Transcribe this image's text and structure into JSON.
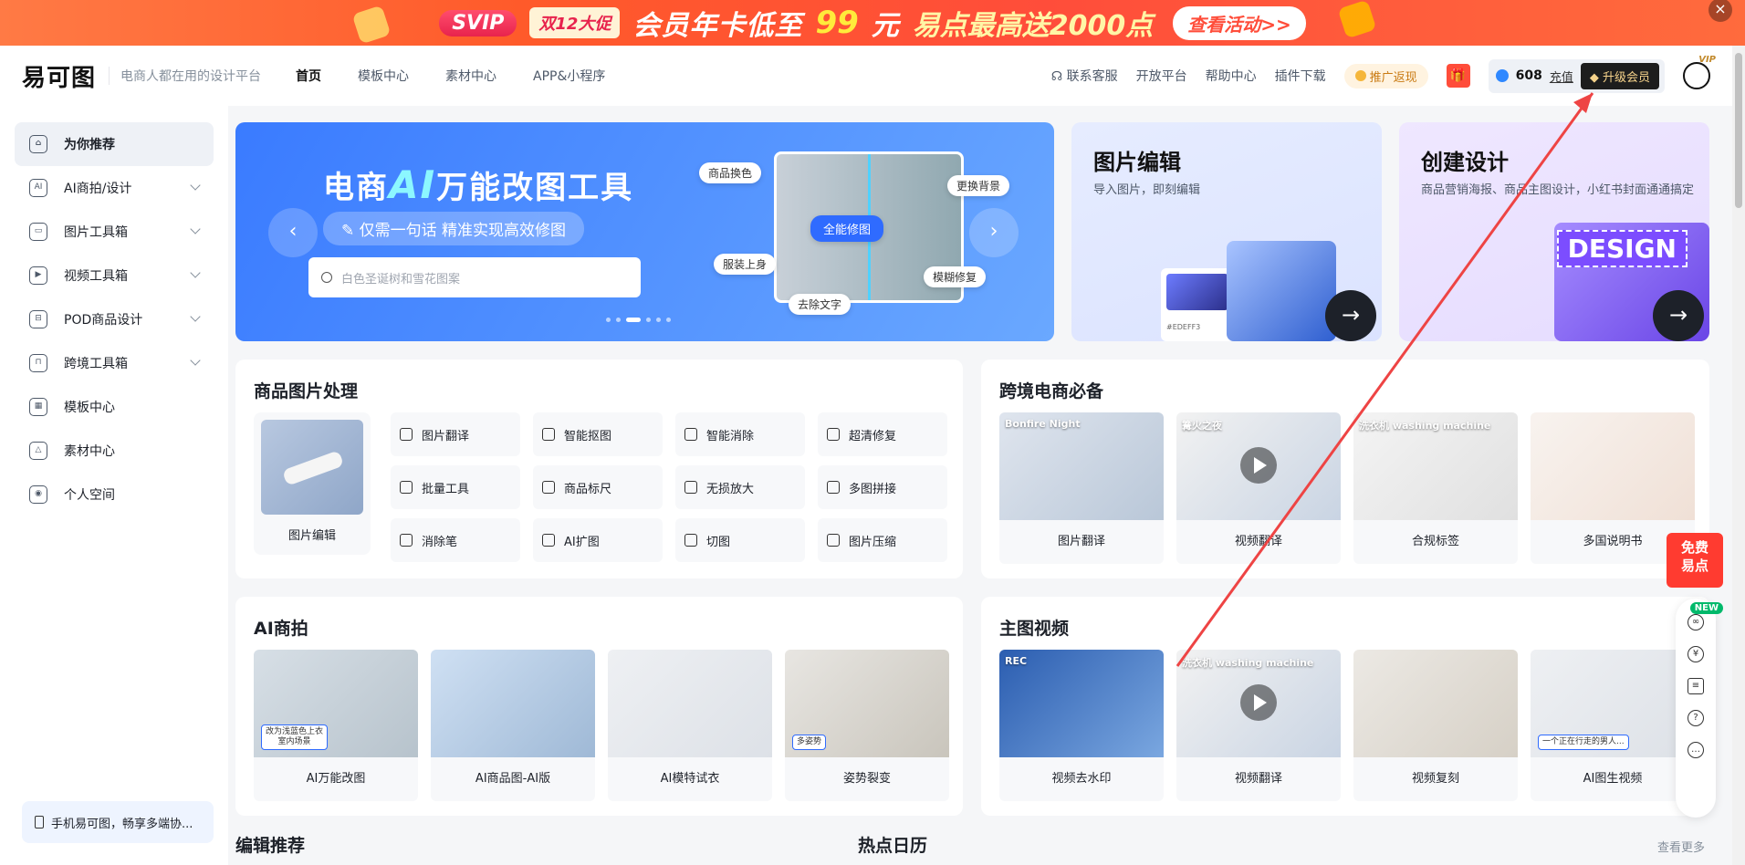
{
  "promo": {
    "svip": "SVIP",
    "double12": "双12大促",
    "text1": "会员年卡低至",
    "price": "99",
    "unit": "元",
    "text2": "易点最高送2000点",
    "cta": "查看活动>>",
    "close": "×"
  },
  "header": {
    "logo": "易可图",
    "slogan": "电商人都在用的设计平台",
    "nav": [
      "首页",
      "模板中心",
      "素材中心",
      "APP&小程序"
    ],
    "links": [
      "联系客服",
      "开放平台",
      "帮助中心",
      "插件下载"
    ],
    "promo_return": "推广返现",
    "points": "608",
    "recharge": "充值",
    "upgrade": "升级会员",
    "vip": "VIP"
  },
  "sidebar": {
    "items": [
      {
        "label": "为你推荐",
        "icon": "home-icon",
        "glyph": "⌂",
        "chevron": false
      },
      {
        "label": "AI商拍/设计",
        "icon": "ai-icon",
        "glyph": "AI",
        "chevron": true
      },
      {
        "label": "图片工具箱",
        "icon": "toolbox-icon",
        "glyph": "▭",
        "chevron": true
      },
      {
        "label": "视频工具箱",
        "icon": "video-icon",
        "glyph": "▶",
        "chevron": true
      },
      {
        "label": "POD商品设计",
        "icon": "pod-icon",
        "glyph": "⊟",
        "chevron": true
      },
      {
        "label": "跨境工具箱",
        "icon": "crossborder-icon",
        "glyph": "⊓",
        "chevron": true
      },
      {
        "label": "模板中心",
        "icon": "template-icon",
        "glyph": "▦",
        "chevron": false
      },
      {
        "label": "素材中心",
        "icon": "material-icon",
        "glyph": "△",
        "chevron": false
      },
      {
        "label": "个人空间",
        "icon": "user-icon",
        "glyph": "◉",
        "chevron": false
      }
    ],
    "bottom": "手机易可图，畅享多端协..."
  },
  "hero": {
    "title_a": "电商",
    "title_ai": "AI",
    "title_b": "万能改图工具",
    "subtitle": "仅需一句话 精准实现高效修图",
    "search_placeholder": "白色圣诞树和雪花图案",
    "tags": [
      "商品换色",
      "更换背景",
      "全能修图",
      "服装上身",
      "模糊修复",
      "去除文字"
    ],
    "prev": "‹",
    "next": "›"
  },
  "card_edit": {
    "title": "图片编辑",
    "subtitle": "导入图片，即刻编辑",
    "go": "→",
    "swatch": "#EDEFF3"
  },
  "card_create": {
    "title": "创建设计",
    "subtitle": "商品营销海报、商品主图设计，小红书封面通通搞定",
    "go": "→",
    "design": "DESIGN"
  },
  "product_tools": {
    "title": "商品图片处理",
    "big": "图片编辑",
    "tools": [
      "图片翻译",
      "智能抠图",
      "智能消除",
      "超清修复",
      "批量工具",
      "商品标尺",
      "无损放大",
      "多图拼接",
      "消除笔",
      "AI扩图",
      "切图",
      "图片压缩"
    ]
  },
  "crossborder": {
    "title": "跨境电商必备",
    "items": [
      "图片翻译",
      "视频翻译",
      "合规标签",
      "多国说明书"
    ],
    "overlay": [
      "Bonfire Night",
      "篝火之夜",
      "洗衣机 washing machine",
      ""
    ]
  },
  "ai_shoot": {
    "title": "AI商拍",
    "items": [
      "AI万能改图",
      "AI商品图-AI版",
      "AI模特试衣",
      "姿势裂变"
    ],
    "minis": [
      "改为浅蓝色上衣\n室内场景",
      "",
      "",
      "多姿势"
    ]
  },
  "main_video": {
    "title": "主图视频",
    "items": [
      "视频去水印",
      "视频翻译",
      "视频复刻",
      "AI图生视频"
    ],
    "minis": [
      "",
      "",
      "",
      "一个正在行走的男人..."
    ],
    "overlay": [
      "REC",
      "洗衣机 washing machine",
      "",
      ""
    ]
  },
  "bottom": {
    "editor_pick": "编辑推荐",
    "hot_calendar": "热点日历",
    "more": "查看更多"
  },
  "float": {
    "free": "免费易点",
    "new": "NEW"
  },
  "colors": {
    "brand_blue": "#2f6bff",
    "promo_orange": "#ff5a2a",
    "annotation_red": "#ee4444"
  }
}
